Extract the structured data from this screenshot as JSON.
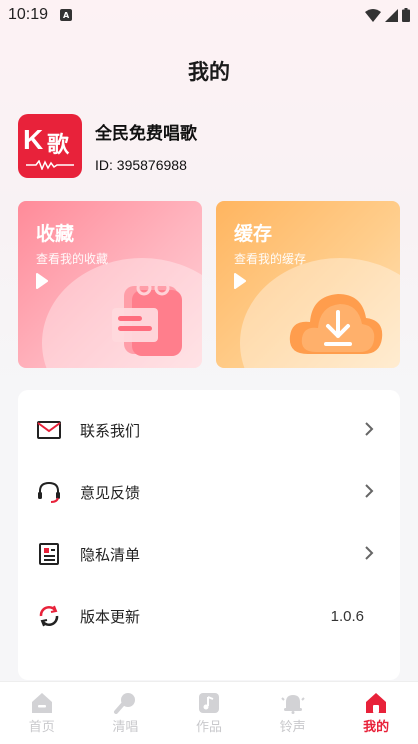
{
  "status_bar": {
    "time": "10:19",
    "sim_label": "A"
  },
  "page": {
    "title": "我的"
  },
  "app": {
    "logo_k": "K",
    "logo_ge": "歌",
    "name": "全民免费唱歌",
    "id_text": "ID: 395876988"
  },
  "cards": {
    "favorites": {
      "title": "收藏",
      "subtitle": "查看我的收藏"
    },
    "cache": {
      "title": "缓存",
      "subtitle": "查看我的缓存"
    }
  },
  "menu": {
    "items": [
      {
        "label": "联系我们",
        "icon": "mail-icon"
      },
      {
        "label": "意见反馈",
        "icon": "headset-icon"
      },
      {
        "label": "隐私清单",
        "icon": "document-list-icon"
      },
      {
        "label": "版本更新",
        "icon": "refresh-icon",
        "value": "1.0.6"
      }
    ]
  },
  "tabbar": {
    "items": [
      {
        "label": "首页",
        "icon": "home-icon",
        "active": false
      },
      {
        "label": "清唱",
        "icon": "microphone-icon",
        "active": false
      },
      {
        "label": "作品",
        "icon": "music-note-icon",
        "active": false
      },
      {
        "label": "铃声",
        "icon": "bell-icon",
        "active": false
      },
      {
        "label": "我的",
        "icon": "house-active-icon",
        "active": true
      }
    ]
  },
  "colors": {
    "accent": "#e8223a",
    "fav_card": "#ff8b99",
    "cache_card": "#ffb560",
    "tab_inactive": "#c9c9cc"
  }
}
